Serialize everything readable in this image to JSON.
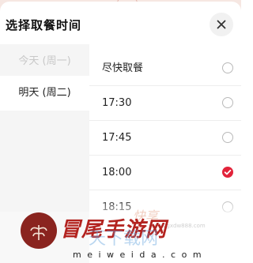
{
  "header": {
    "title": "选择取餐时间"
  },
  "days": [
    {
      "label": "今天 (周一)",
      "selected": false
    },
    {
      "label": "明天 (周二)",
      "selected": true
    }
  ],
  "time_options": [
    {
      "label": "尽快取餐",
      "checked": false
    },
    {
      "label": "17:30",
      "checked": false
    },
    {
      "label": "17:45",
      "checked": false
    },
    {
      "label": "18:00",
      "checked": true
    },
    {
      "label": "18:15",
      "checked": false
    }
  ],
  "watermark": {
    "title": "冒尾手游网",
    "url": "m e i w e i d a . c o m",
    "overlay": "天下载网",
    "top_mark": "快享",
    "tiny": "www.zgxdw888.com"
  },
  "colors": {
    "accent": "#e2233a",
    "watermark_red": "#b3231f",
    "logo_bg": "#8a241f"
  }
}
